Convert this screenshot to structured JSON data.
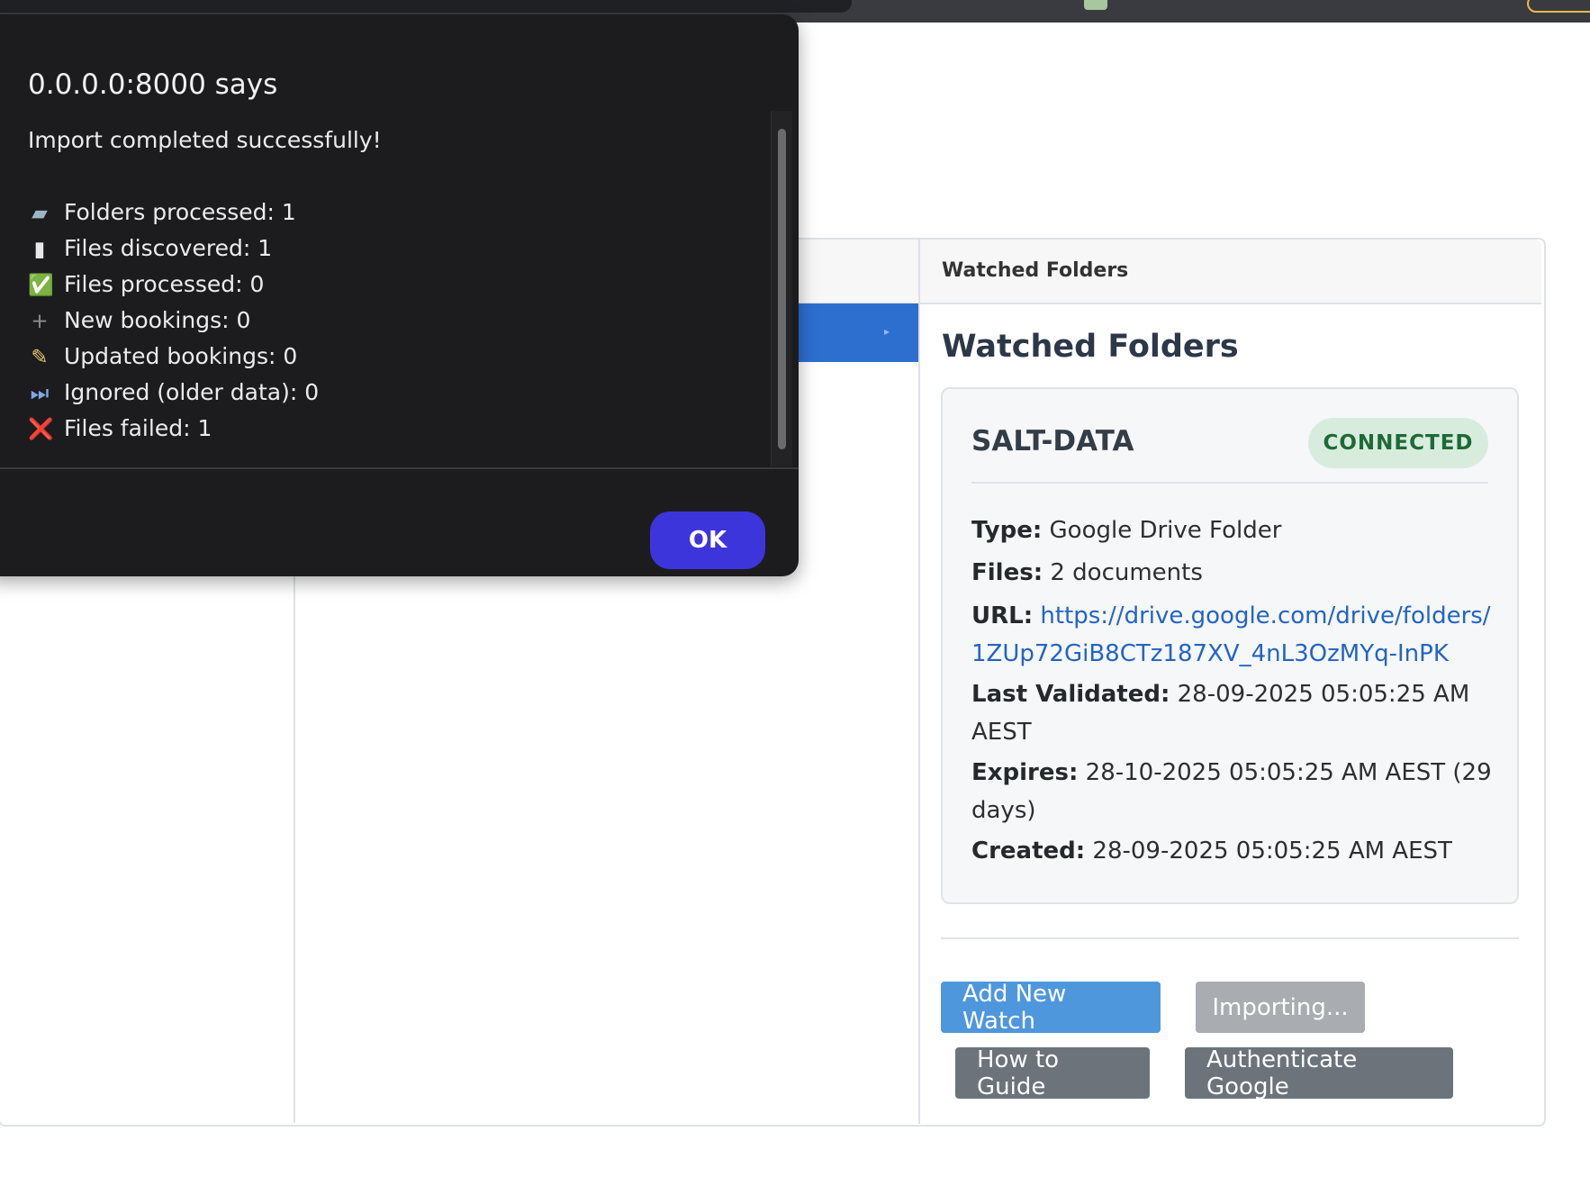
{
  "dialog": {
    "title": "0.0.0.0:8000 says",
    "message": "Import completed successfully!",
    "stats": [
      {
        "icon": "folder-icon",
        "glyph": "▰",
        "text": "Folders processed: 1"
      },
      {
        "icon": "document-icon",
        "glyph": "▮",
        "text": "Files discovered: 1"
      },
      {
        "icon": "check-mark-icon",
        "glyph": "✅",
        "text": "Files processed: 0"
      },
      {
        "icon": "plus-icon",
        "glyph": "+",
        "text": "New bookings: 0"
      },
      {
        "icon": "memo-icon",
        "glyph": "✎",
        "text": "Updated bookings: 0"
      },
      {
        "icon": "skip-forward-icon",
        "glyph": "⏭",
        "text": "Ignored (older data): 0"
      },
      {
        "icon": "cross-mark-icon",
        "glyph": "❌",
        "text": "Files failed: 1"
      }
    ],
    "ok_label": "OK"
  },
  "panel": {
    "header": "Watched Folders",
    "title": "Watched Folders",
    "folder": {
      "name": "SALT-DATA",
      "status": "CONNECTED",
      "type_label": "Type:",
      "type_value": "Google Drive Folder",
      "files_label": "Files:",
      "files_value": "2 documents",
      "url_label": "URL:",
      "url_value": "https://drive.google.com/drive/folders/1ZUp72GiB8CTz187XV_4nL3OzMYq-InPK",
      "last_validated_label": "Last Validated:",
      "last_validated_value": "28-09-2025 05:05:25 AM AEST",
      "expires_label": "Expires:",
      "expires_value": "28-10-2025 05:05:25 AM AEST (29 days)",
      "created_label": "Created:",
      "created_value": "28-09-2025 05:05:25 AM AEST"
    },
    "buttons": {
      "add_new_watch": "Add New Watch",
      "importing": "Importing...",
      "how_to_guide": "How to Guide",
      "authenticate_google": "Authenticate Google"
    }
  },
  "colors": {
    "dialog_bg": "#1c1c1f",
    "ok_button": "#3d35dc",
    "active_row": "#2d6fcf",
    "badge_bg": "#d8ecdd",
    "badge_text": "#1e6a37",
    "link": "#2364c4",
    "primary_button": "#4f97dd",
    "secondary_button": "#6c737b",
    "disabled_button": "#a9acb0"
  }
}
